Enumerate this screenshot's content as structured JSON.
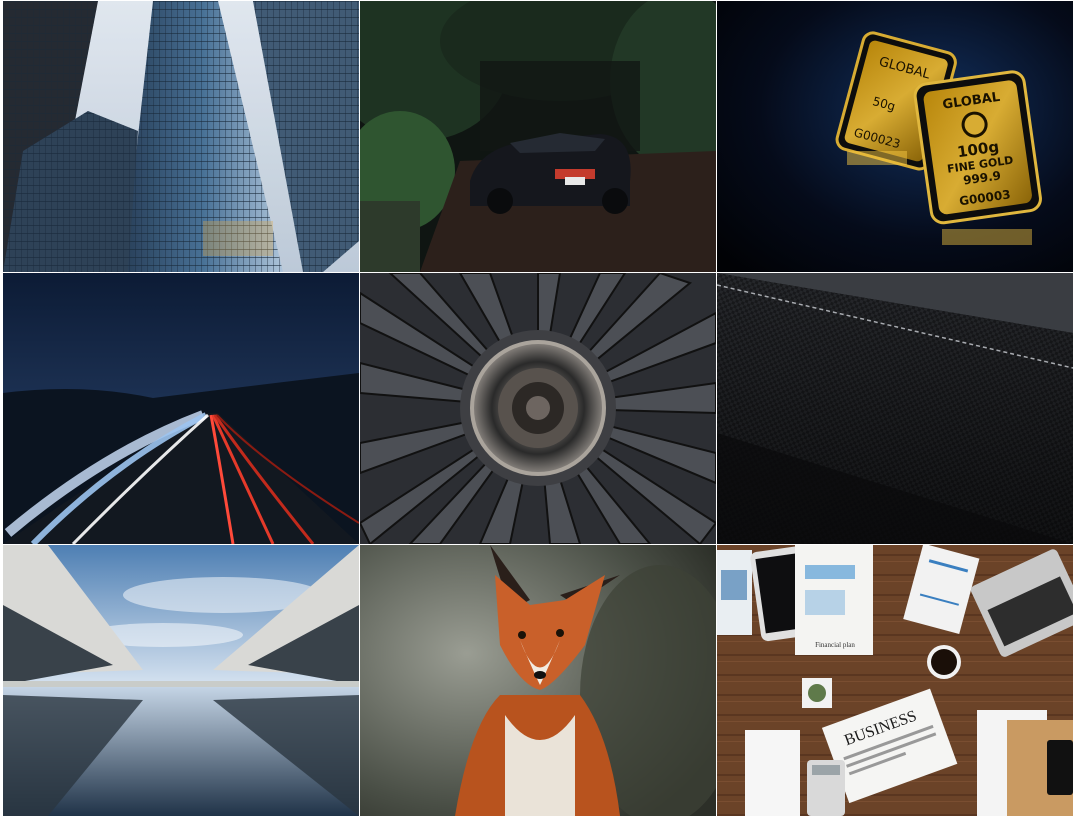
{
  "gallery": {
    "tiles": [
      {
        "subject": "skyscrapers-photo"
      },
      {
        "subject": "sports-car-photo"
      },
      {
        "subject": "gold-bars-photo"
      },
      {
        "subject": "highway-light-trails-photo"
      },
      {
        "subject": "jet-engine-photo"
      },
      {
        "subject": "carbon-fiber-photo"
      },
      {
        "subject": "reflecting-pool-architecture-photo"
      },
      {
        "subject": "fox-photo"
      },
      {
        "subject": "business-desk-photo"
      }
    ],
    "gold_bar": {
      "brand": "GLOBAL",
      "weight": "100g",
      "grade": "FINE GOLD",
      "purity": "999.9",
      "serial_front": "G00003",
      "serial_back": "G00023",
      "weight_back": "50g"
    },
    "desk": {
      "newspaper_headline": "BUSINESS",
      "clipboard_caption": "Financial plan"
    }
  }
}
